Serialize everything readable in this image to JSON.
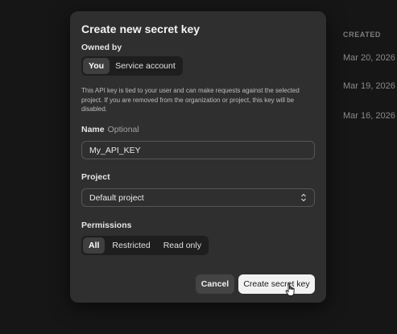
{
  "background": {
    "column_header": "CREATED",
    "dates": [
      "Mar 20, 2026",
      "Mar 19, 2026",
      "Mar 16, 2026"
    ]
  },
  "modal": {
    "title": "Create new secret key",
    "owned_by": {
      "label": "Owned by",
      "options": [
        "You",
        "Service account"
      ],
      "selected": "You"
    },
    "description": "This API key is tied to your user and can make requests against the selected project. If you are removed from the organization or project, this key will be disabled.",
    "name": {
      "label": "Name",
      "optional_label": "Optional",
      "value": "My_API_KEY"
    },
    "project": {
      "label": "Project",
      "value": "Default project"
    },
    "permissions": {
      "label": "Permissions",
      "options": [
        "All",
        "Restricted",
        "Read only"
      ],
      "selected": "All"
    },
    "buttons": {
      "cancel": "Cancel",
      "create": "Create secret key"
    }
  },
  "colors": {
    "modal_bg": "#2f2f2f",
    "page_bg": "#161616",
    "primary_button": "#f2f2f2"
  }
}
